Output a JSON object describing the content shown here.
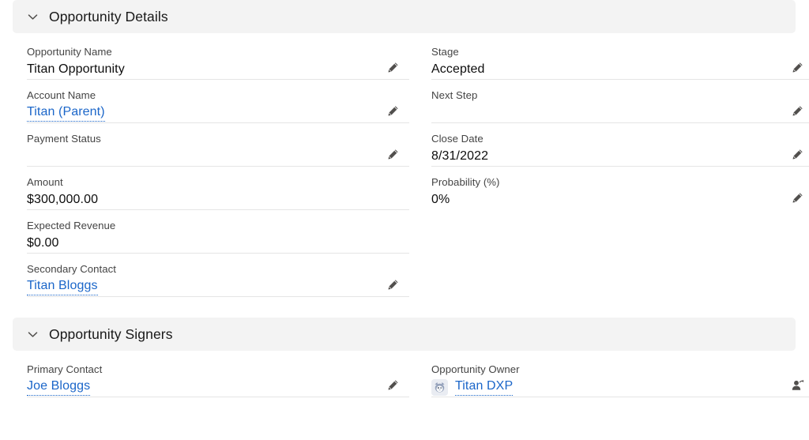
{
  "theme": {
    "header_bg": "#f3f3f3",
    "link_color": "#1b66c9",
    "label_color": "#444444",
    "value_color": "#0d0d0d",
    "divider_color": "#e5e5e5",
    "icon_color": "#514f4d"
  },
  "sections": [
    {
      "id": "opportunity-details",
      "title": "Opportunity Details",
      "collapse_icon": "chevron-down-icon",
      "left_fields": [
        {
          "label": "Opportunity Name",
          "value": "Titan Opportunity",
          "type": "text",
          "action": "pencil-icon"
        },
        {
          "label": "Account Name",
          "value": "Titan (Parent)",
          "type": "link",
          "action": "pencil-icon"
        },
        {
          "label": "Payment Status",
          "value": "",
          "type": "text",
          "action": "pencil-icon"
        },
        {
          "label": "Amount",
          "value": "$300,000.00",
          "type": "text",
          "action": "none"
        },
        {
          "label": "Expected Revenue",
          "value": "$0.00",
          "type": "text",
          "action": "none"
        },
        {
          "label": "Secondary Contact",
          "value": "Titan Bloggs",
          "type": "link",
          "action": "pencil-icon"
        }
      ],
      "right_fields": [
        {
          "label": "Stage",
          "value": "Accepted",
          "type": "text",
          "action": "pencil-icon"
        },
        {
          "label": "Next Step",
          "value": "",
          "type": "text",
          "action": "pencil-icon"
        },
        {
          "label": "Close Date",
          "value": "8/31/2022",
          "type": "text",
          "action": "pencil-icon"
        },
        {
          "label": "Probability (%)",
          "value": "0%",
          "type": "text",
          "action": "pencil-icon"
        }
      ]
    },
    {
      "id": "opportunity-signers",
      "title": "Opportunity Signers",
      "collapse_icon": "chevron-down-icon",
      "left_fields": [
        {
          "label": "Primary Contact",
          "value": "Joe Bloggs",
          "type": "link",
          "action": "pencil-icon"
        }
      ],
      "right_fields": [
        {
          "label": "Opportunity Owner",
          "value": "Titan DXP",
          "type": "link",
          "avatar": "user-avatar-icon",
          "action": "change-owner-icon"
        }
      ]
    }
  ]
}
